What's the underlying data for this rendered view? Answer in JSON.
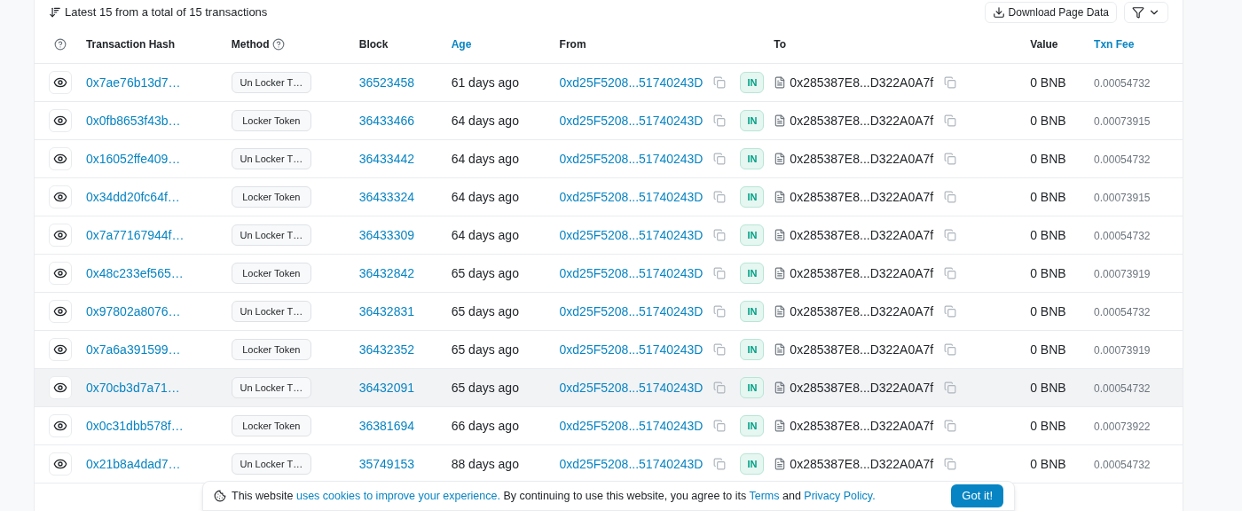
{
  "summary": "Latest 15 from a total of 15 transactions",
  "toolbar": {
    "download": "Download Page Data"
  },
  "table": {
    "columns": [
      "Transaction Hash",
      "Method",
      "Block",
      "Age",
      "From",
      "To",
      "Value",
      "Txn Fee"
    ],
    "rows": [
      {
        "hash": "0x7ae76b13d7…",
        "method": "Un Locker T…",
        "block": "36523458",
        "age": "61 days ago",
        "from": "0xd25F5208...51740243D",
        "direction": "IN",
        "to": "0x285387E8...D322A0A7f",
        "value": "0 BNB",
        "fee": "0.00054732",
        "selected": false
      },
      {
        "hash": "0x0fb8653f43b…",
        "method": "Locker Token",
        "block": "36433466",
        "age": "64 days ago",
        "from": "0xd25F5208...51740243D",
        "direction": "IN",
        "to": "0x285387E8...D322A0A7f",
        "value": "0 BNB",
        "fee": "0.00073915",
        "selected": false
      },
      {
        "hash": "0x16052ffe409…",
        "method": "Un Locker T…",
        "block": "36433442",
        "age": "64 days ago",
        "from": "0xd25F5208...51740243D",
        "direction": "IN",
        "to": "0x285387E8...D322A0A7f",
        "value": "0 BNB",
        "fee": "0.00054732",
        "selected": false
      },
      {
        "hash": "0x34dd20fc64f…",
        "method": "Locker Token",
        "block": "36433324",
        "age": "64 days ago",
        "from": "0xd25F5208...51740243D",
        "direction": "IN",
        "to": "0x285387E8...D322A0A7f",
        "value": "0 BNB",
        "fee": "0.00073915",
        "selected": false
      },
      {
        "hash": "0x7a77167944f…",
        "method": "Un Locker T…",
        "block": "36433309",
        "age": "64 days ago",
        "from": "0xd25F5208...51740243D",
        "direction": "IN",
        "to": "0x285387E8...D322A0A7f",
        "value": "0 BNB",
        "fee": "0.00054732",
        "selected": false
      },
      {
        "hash": "0x48c233ef565…",
        "method": "Locker Token",
        "block": "36432842",
        "age": "65 days ago",
        "from": "0xd25F5208...51740243D",
        "direction": "IN",
        "to": "0x285387E8...D322A0A7f",
        "value": "0 BNB",
        "fee": "0.00073919",
        "selected": false
      },
      {
        "hash": "0x97802a8076…",
        "method": "Un Locker T…",
        "block": "36432831",
        "age": "65 days ago",
        "from": "0xd25F5208...51740243D",
        "direction": "IN",
        "to": "0x285387E8...D322A0A7f",
        "value": "0 BNB",
        "fee": "0.00054732",
        "selected": false
      },
      {
        "hash": "0x7a6a391599…",
        "method": "Locker Token",
        "block": "36432352",
        "age": "65 days ago",
        "from": "0xd25F5208...51740243D",
        "direction": "IN",
        "to": "0x285387E8...D322A0A7f",
        "value": "0 BNB",
        "fee": "0.00073919",
        "selected": false
      },
      {
        "hash": "0x70cb3d7a71…",
        "method": "Un Locker T…",
        "block": "36432091",
        "age": "65 days ago",
        "from": "0xd25F5208...51740243D",
        "direction": "IN",
        "to": "0x285387E8...D322A0A7f",
        "value": "0 BNB",
        "fee": "0.00054732",
        "selected": true
      },
      {
        "hash": "0x0c31dbb578f…",
        "method": "Locker Token",
        "block": "36381694",
        "age": "66 days ago",
        "from": "0xd25F5208...51740243D",
        "direction": "IN",
        "to": "0x285387E8...D322A0A7f",
        "value": "0 BNB",
        "fee": "0.00073922",
        "selected": false
      },
      {
        "hash": "0x21b8a4dad7…",
        "method": "Un Locker T…",
        "block": "35749153",
        "age": "88 days ago",
        "from": "0xd25F5208...51740243D",
        "direction": "IN",
        "to": "0x285387E8...D322A0A7f",
        "value": "0 BNB",
        "fee": "0.00054732",
        "selected": false
      }
    ]
  },
  "cookie_banner": {
    "text_before": "This website",
    "link": "uses cookies to improve your experience.",
    "text_middle": "By continuing to use this website, you agree to its",
    "terms": "Terms",
    "and": "and",
    "privacy": "Privacy Policy.",
    "button": "Got it!"
  }
}
